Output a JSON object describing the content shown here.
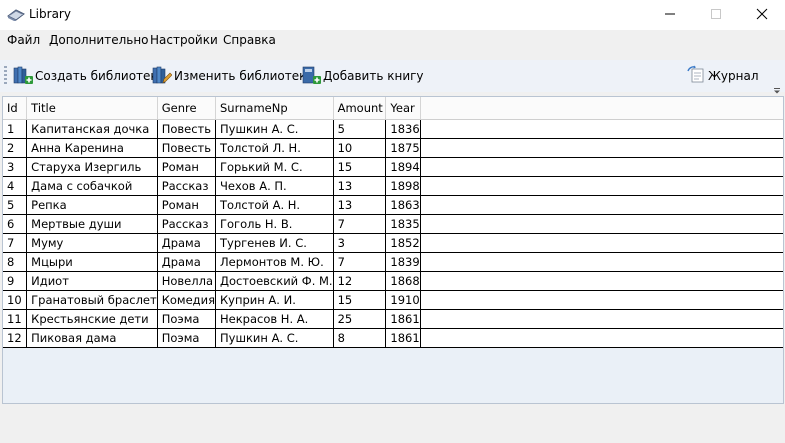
{
  "window": {
    "title": "Library",
    "controls": [
      "—",
      "☐",
      "✕"
    ]
  },
  "menu": [
    "Файл",
    "Дополнительно",
    "Настройки",
    "Справка"
  ],
  "toolbar": {
    "create_library": "Создать библиотеку",
    "edit_library": "Изменить библиотеку",
    "add_book": "Добавить книгу",
    "journal": "Журнал"
  },
  "table": {
    "columns": [
      "Id",
      "Title",
      "Genre",
      "SurnameNp",
      "Amount",
      "Year"
    ],
    "rows": [
      [
        "1",
        "Капитанская дочка",
        "Повесть",
        "Пушкин А. С.",
        "5",
        "1836"
      ],
      [
        "2",
        "Анна Каренина",
        "Повесть",
        "Толстой Л. Н.",
        "10",
        "1875"
      ],
      [
        "3",
        "Старуха Изергиль",
        "Роман",
        "Горький М. С.",
        "15",
        "1894"
      ],
      [
        "4",
        "Дама с собачкой",
        "Рассказ",
        "Чехов А. П.",
        "13",
        "1898"
      ],
      [
        "5",
        "Репка",
        "Роман",
        "Толстой А. Н.",
        "13",
        "1863"
      ],
      [
        "6",
        "Мертвые души",
        "Рассказ",
        "Гоголь Н. В.",
        "7",
        "1835"
      ],
      [
        "7",
        "Муму",
        "Драма",
        "Тургенев И. С.",
        "3",
        "1852"
      ],
      [
        "8",
        "Мцыри",
        "Драма",
        "Лермонтов М. Ю.",
        "7",
        "1839"
      ],
      [
        "9",
        "Идиот",
        "Новелла",
        "Достоевский Ф. М.",
        "12",
        "1868"
      ],
      [
        "10",
        "Гранатовый браслет",
        "Комедия",
        "Куприн А. И.",
        "15",
        "1910"
      ],
      [
        "11",
        "Крестьянские дети",
        "Поэма",
        "Некрасов Н. А.",
        "25",
        "1861"
      ],
      [
        "12",
        "Пиковая дама",
        "Поэма",
        "Пушкин А. С.",
        "8",
        "1861"
      ]
    ]
  }
}
